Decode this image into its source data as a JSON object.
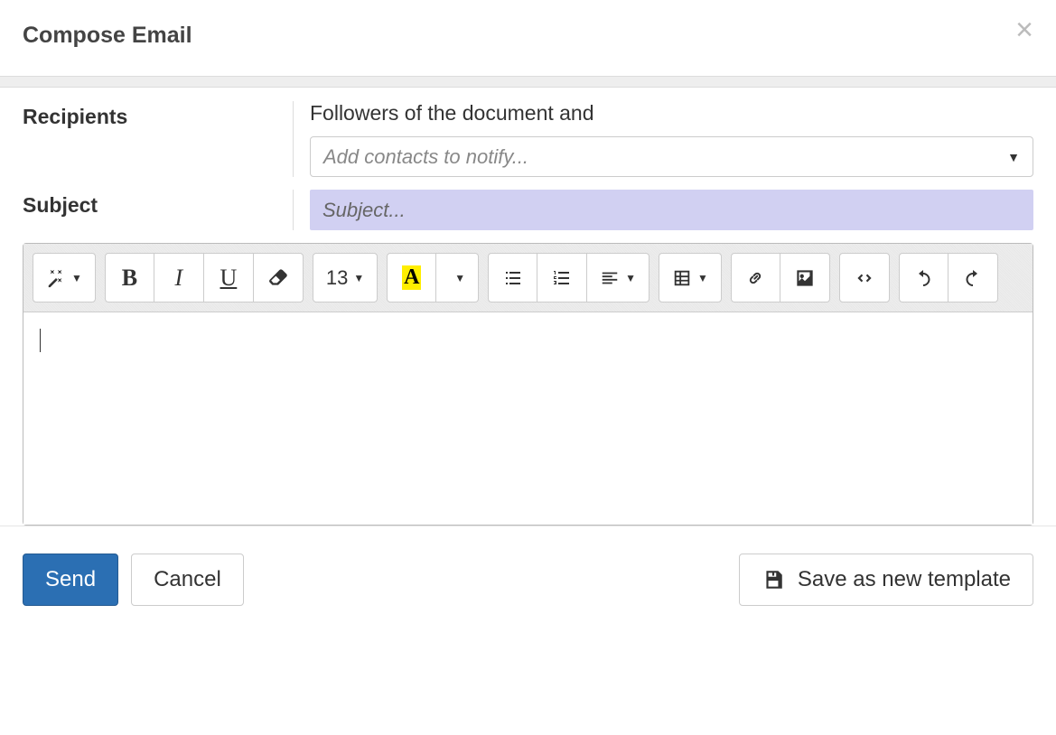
{
  "header": {
    "title": "Compose Email"
  },
  "form": {
    "recipients_label": "Recipients",
    "followers_text": "Followers of the document and",
    "contacts_placeholder": "Add contacts to notify...",
    "subject_label": "Subject",
    "subject_placeholder": "Subject..."
  },
  "toolbar": {
    "font_size": "13"
  },
  "footer": {
    "send": "Send",
    "cancel": "Cancel",
    "save_template": "Save as new template"
  }
}
